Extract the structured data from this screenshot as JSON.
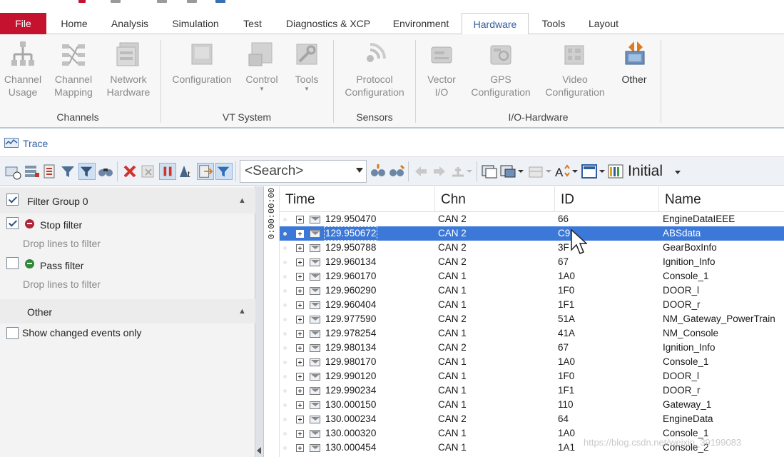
{
  "menu_tabs": [
    {
      "label": "File"
    },
    {
      "label": "Home"
    },
    {
      "label": "Analysis"
    },
    {
      "label": "Simulation"
    },
    {
      "label": "Test"
    },
    {
      "label": "Diagnostics & XCP"
    },
    {
      "label": "Environment"
    },
    {
      "label": "Hardware"
    },
    {
      "label": "Tools"
    },
    {
      "label": "Layout"
    }
  ],
  "active_tab": "Hardware",
  "ribbon": {
    "buttons": [
      {
        "l1": "Channel",
        "l2": "Usage",
        "icon": "channel-usage-icon",
        "enabled": false,
        "dropdown": false
      },
      {
        "l1": "Channel",
        "l2": "Mapping",
        "icon": "channel-mapping-icon",
        "enabled": false,
        "dropdown": false
      },
      {
        "l1": "Network",
        "l2": "Hardware",
        "icon": "network-hardware-icon",
        "enabled": false,
        "dropdown": false
      },
      {
        "l1": "Configuration",
        "l2": "",
        "icon": "vt-configuration-icon",
        "enabled": false,
        "dropdown": false
      },
      {
        "l1": "Control",
        "l2": "",
        "icon": "vt-control-icon",
        "enabled": false,
        "dropdown": true
      },
      {
        "l1": "Tools",
        "l2": "",
        "icon": "vt-tools-icon",
        "enabled": false,
        "dropdown": true
      },
      {
        "l1": "Protocol",
        "l2": "Configuration",
        "icon": "protocol-configuration-icon",
        "enabled": false,
        "dropdown": false
      },
      {
        "l1": "Vector",
        "l2": "I/O",
        "icon": "vector-io-icon",
        "enabled": false,
        "dropdown": false
      },
      {
        "l1": "GPS",
        "l2": "Configuration",
        "icon": "gps-configuration-icon",
        "enabled": false,
        "dropdown": false
      },
      {
        "l1": "Video",
        "l2": "Configuration",
        "icon": "video-configuration-icon",
        "enabled": false,
        "dropdown": false
      },
      {
        "l1": "Other",
        "l2": "",
        "icon": "other-hardware-icon",
        "enabled": true,
        "dropdown": false
      }
    ],
    "groups": [
      {
        "label": "Channels"
      },
      {
        "label": "VT System"
      },
      {
        "label": "Sensors"
      },
      {
        "label": "I/O-Hardware"
      }
    ]
  },
  "trace_window": {
    "title": "Trace",
    "icon": "trace-icon"
  },
  "toolbar": {
    "search_placeholder": "<Search>",
    "config_label": "Initial",
    "icons": [
      "add-filter-icon",
      "display-mode-icon",
      "chronological-icon",
      "filter-icon",
      "filter-funnel-icon",
      "find-icon",
      "delete-icon",
      "clear-icon",
      "pause-icon",
      "time-delta-icon",
      "export-icon",
      "column-filter-icon",
      "find-next-icon",
      "find-prev-icon",
      "back-icon",
      "forward-icon",
      "marker-icon",
      "window-icon",
      "window-dropdown-icon",
      "grid-options-icon",
      "font-size-icon",
      "layout-icon",
      "column-config-icon"
    ]
  },
  "filter_panel": {
    "group_title": "Filter Group 0",
    "group_checked": true,
    "stop_filter": {
      "label": "Stop filter",
      "hint": "Drop lines to filter",
      "checked": true
    },
    "pass_filter": {
      "label": "Pass filter",
      "hint": "Drop lines to filter",
      "checked": false
    },
    "other_title": "Other",
    "show_changed": {
      "label": "Show changed events only",
      "checked": false
    }
  },
  "ruler_text": "0:00:00:00",
  "columns": [
    {
      "key": "time",
      "label": "Time"
    },
    {
      "key": "chn",
      "label": "Chn"
    },
    {
      "key": "id",
      "label": "ID"
    },
    {
      "key": "name",
      "label": "Name"
    }
  ],
  "rows": [
    {
      "time": "129.950470",
      "chn": "CAN 2",
      "id": "66",
      "name": "EngineDataIEEE"
    },
    {
      "time": "129.950672",
      "chn": "CAN 2",
      "id": "C9",
      "name": "ABSdata",
      "selected": true
    },
    {
      "time": "129.950788",
      "chn": "CAN 2",
      "id": "3F",
      "name": "GearBoxInfo"
    },
    {
      "time": "129.960134",
      "chn": "CAN 2",
      "id": "67",
      "name": "Ignition_Info"
    },
    {
      "time": "129.960170",
      "chn": "CAN 1",
      "id": "1A0",
      "name": "Console_1"
    },
    {
      "time": "129.960290",
      "chn": "CAN 1",
      "id": "1F0",
      "name": "DOOR_l"
    },
    {
      "time": "129.960404",
      "chn": "CAN 1",
      "id": "1F1",
      "name": "DOOR_r"
    },
    {
      "time": "129.977590",
      "chn": "CAN 2",
      "id": "51A",
      "name": "NM_Gateway_PowerTrain"
    },
    {
      "time": "129.978254",
      "chn": "CAN 1",
      "id": "41A",
      "name": "NM_Console"
    },
    {
      "time": "129.980134",
      "chn": "CAN 2",
      "id": "67",
      "name": "Ignition_Info"
    },
    {
      "time": "129.980170",
      "chn": "CAN 1",
      "id": "1A0",
      "name": "Console_1"
    },
    {
      "time": "129.990120",
      "chn": "CAN 1",
      "id": "1F0",
      "name": "DOOR_l"
    },
    {
      "time": "129.990234",
      "chn": "CAN 1",
      "id": "1F1",
      "name": "DOOR_r"
    },
    {
      "time": "130.000150",
      "chn": "CAN 1",
      "id": "110",
      "name": "Gateway_1"
    },
    {
      "time": "130.000234",
      "chn": "CAN 2",
      "id": "64",
      "name": "EngineData"
    },
    {
      "time": "130.000320",
      "chn": "CAN 1",
      "id": "1A0",
      "name": "Console_1"
    },
    {
      "time": "130.000454",
      "chn": "CAN 1",
      "id": "1A1",
      "name": "Console_2"
    }
  ],
  "watermark": "https://blog.csdn.net/weixin_39199083",
  "colors": {
    "file_tab": "#c4122f",
    "active_tab_text": "#2f5e9f",
    "selection": "#3c78d8",
    "stop_filter_icon": "#b3243a",
    "pass_filter_icon": "#2f8a3a"
  }
}
